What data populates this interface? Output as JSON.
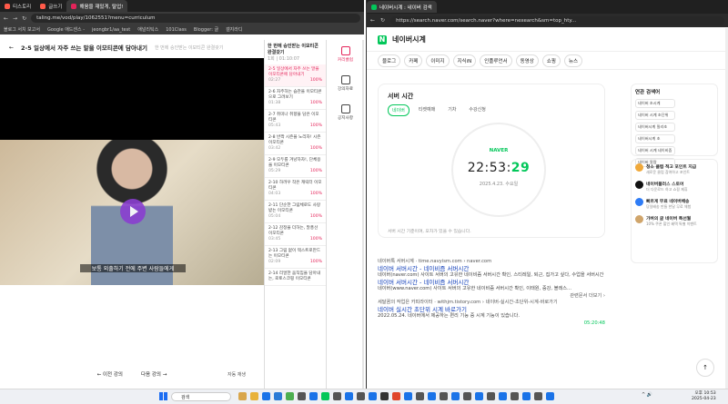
{
  "left": {
    "tabs": [
      {
        "label": "티스토리",
        "color": "#ff5a4a"
      },
      {
        "label": "글쓰기",
        "color": "#ff5a4a"
      },
      {
        "label": "해움을 재밌게, 탈업!",
        "color": "#e4245a"
      }
    ],
    "url": "taling.me/vod/play/1062551?menu=curriculum",
    "bookmarks": [
      "블로그 서치 보고서",
      "Google 애드센스 -",
      "jeongbr1/aa_test",
      "애널리틱스",
      "101Class",
      "Blogger: 글",
      "갤지라디"
    ],
    "lecture_title": "2-5 일상에서 자주 쓰는 말을 이모티콘에 담아내기",
    "lecture_sub": "한 번에 승인받는 이모티콘 완결갖기",
    "subtitle": "보통 외출하기 전에 주변 사람들에게",
    "prev": "← 이전 강의",
    "next": "다음 강의 →",
    "autoplay": "자동 재생",
    "list_header": "한 번에 승인받는 이모티콘 완결갖기",
    "list_time": "1회 | 01:10:07",
    "items": [
      {
        "t": "2-5 일상에서 자주 쓰는 말을 이모티콘에 담아내기",
        "d": "02:27",
        "p": "100%",
        "on": true
      },
      {
        "t": "2-6 자주하는 습관을 이모티콘으로 그려보기",
        "d": "01:38",
        "p": "100%"
      },
      {
        "t": "2-7 취미나 취향을 담은 이모티콘",
        "d": "05:43",
        "p": "100%"
      },
      {
        "t": "2-8 반짝 시즌을 노리자! 시즌 이모티콘",
        "d": "03:42",
        "p": "100%"
      },
      {
        "t": "2-9 모두를 겨냥하자!, 단체용을 이모티콘",
        "d": "05:29",
        "p": "100%"
      },
      {
        "t": "2-10 하려우 작은 캐릭터 이모티콘",
        "d": "04:03",
        "p": "100%"
      },
      {
        "t": "2-11 단순한 그림체로도 사랑받는 이모티콘",
        "d": "05:04",
        "p": "100%"
      },
      {
        "t": "2-12 감정을 더하는, 말풍선 이모티콘",
        "d": "03:45",
        "p": "100%"
      },
      {
        "t": "2-13 그림 없이 텍스트로만드는 이모티콘",
        "d": "02:09",
        "p": "100%"
      },
      {
        "t": "2-14 리얼한 움직임을 담아내는, 로토스코핑 이모티콘",
        "d": "",
        "p": ""
      }
    ],
    "side": [
      {
        "label": "커리큘럼",
        "on": true
      },
      {
        "label": "강의자료"
      },
      {
        "label": "공지사항"
      }
    ]
  },
  "right": {
    "tab": "네이버시계 : 네이버 검색",
    "url": "https://search.naver.com/search.naver?where=nexearch&sm=top_hty...",
    "query": "네이버시계",
    "cats": [
      "블로그",
      "카페",
      "이미지",
      "지식iN",
      "인플루언서",
      "동영상",
      "쇼핑",
      "뉴스"
    ],
    "card_title": "서버 시간",
    "card_tabs": [
      "네이버",
      "티켓예매",
      "기차",
      "수강신청"
    ],
    "clock_brand": "NAVER",
    "clock_hm": "22:53:",
    "clock_s": "29",
    "clock_date": "2025.4.23. 수요일",
    "clock_note": "서버 시간 기준이며, 오차가 있을 수 있습니다.",
    "r1_src": "네이버톡 서버시계 · time.navyism.com › naver.com",
    "r1_title": "네이버 서버시간 - 네이비즘 서버시간",
    "r1_desc": "네이버(naver.com) 사이트 서버의 고유한 네이비즘 서버시간 확인, 스티레일, 퇴근, 집가고 싶다, 수업을 서버시간",
    "r2_title": "네이버 서버시간 - 네이비즘 서버시간",
    "r2_desc": "네이버(www.naver.com) 사이트 서버의 고유한 네이비즘 서버시간 확인, 이태원, 중강, 블레스...",
    "r_more": "관련문서 더보기 ›",
    "r3_src": "세달꿈의 작업은 카피라이터 · withjm.tistory.com › 네이버-실시간-초단위-시계-바로가기",
    "r3_date": "2022.05.24.",
    "r3_title": "네이버 실시간 초단위 시계 바로가기",
    "r3_desc": "네이버에서 제공하는 편리 기능 중 시계 기능이 있습니다.",
    "r3_thumb": "05:20:48",
    "rel_title": "연관 검색어",
    "related": [
      "네이버 초시계",
      "네이버 시계 초단위",
      "네이버시계 밀리초",
      "네이버시계 초",
      "네이버 시계 네이비즘",
      "네이버 알람"
    ],
    "ads": [
      {
        "n": "청소 클럽 적고 포인트 지급",
        "d": "새로운 클럽 참여하고 포인트",
        "c": "#f0a93b"
      },
      {
        "n": "네이버플러스 스토어",
        "d": "더 다운로드 하고 쇼핑 제휴",
        "c": "#111"
      },
      {
        "n": "빠르게 무료 네이버배송",
        "d": "당일배송 만들 한달 무료 체험",
        "c": "#2e7cf6"
      },
      {
        "n": "가벼의 글 네이버 특선월",
        "d": "10% 쿠폰 할인 혜택 특별 이벤트",
        "c": "#d0a56b"
      }
    ],
    "top": "↑"
  },
  "taskbar": {
    "search": "검색",
    "time": "오후 10:53",
    "date": "2025-04-23"
  }
}
